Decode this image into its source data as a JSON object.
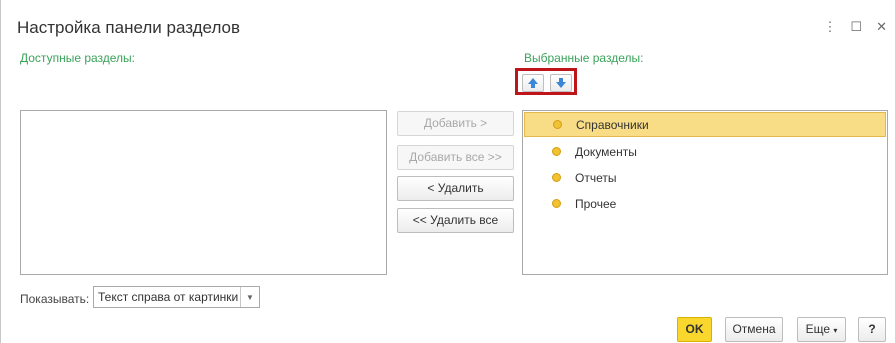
{
  "window": {
    "title": "Настройка панели разделов",
    "menu_glyph": "⋮",
    "maximize_glyph": "☐",
    "close_glyph": "✕"
  },
  "available": {
    "label": "Доступные разделы:",
    "items": []
  },
  "selected": {
    "label": "Выбранные разделы:",
    "items": [
      {
        "label": "Справочники",
        "selected": true
      },
      {
        "label": "Документы",
        "selected": false
      },
      {
        "label": "Отчеты",
        "selected": false
      },
      {
        "label": "Прочее",
        "selected": false
      }
    ]
  },
  "middle_buttons": {
    "add": "Добавить >",
    "add_all": "Добавить все >>",
    "remove": "< Удалить",
    "remove_all": "<< Удалить все"
  },
  "order_buttons": {
    "up_icon": "arrow-up-icon",
    "down_icon": "arrow-down-icon",
    "highlight_color": "#c0141b"
  },
  "show": {
    "label": "Показывать:",
    "value": "Текст справа от картинки"
  },
  "footer": {
    "ok": "OK",
    "cancel": "Отмена",
    "more": "Еще",
    "help": "?"
  },
  "colors": {
    "accent_green": "#3aa35a",
    "ok_yellow": "#f9d72c",
    "selected_row": "#f8dd86",
    "dot_yellow": "#f1c232",
    "arrow_blue": "#3b86d6"
  }
}
